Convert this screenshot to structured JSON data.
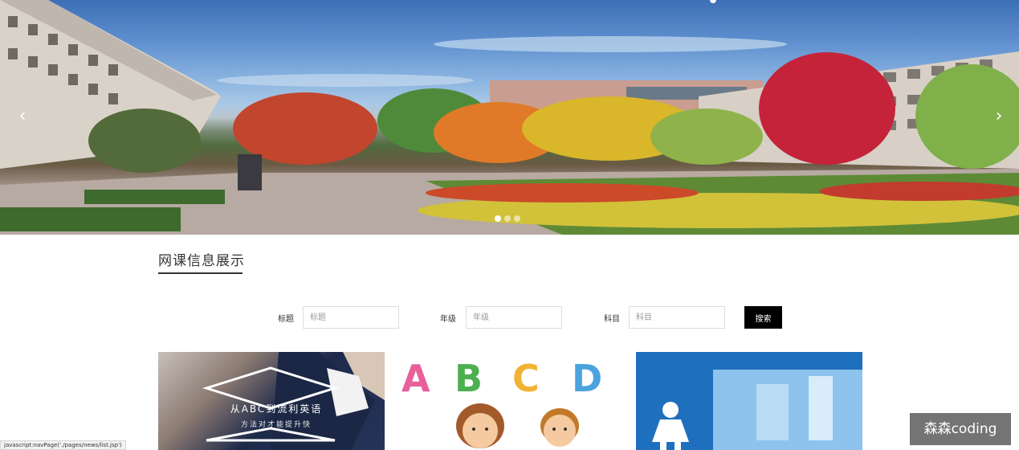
{
  "banner": {
    "prev_arrow": "‹",
    "next_arrow": "›",
    "slide_count": 3,
    "active_slide": 1
  },
  "section": {
    "title": "网课信息展示"
  },
  "search": {
    "title_label": "标题",
    "title_placeholder": "标题",
    "grade_label": "年级",
    "grade_placeholder": "年级",
    "subject_label": "科目",
    "subject_placeholder": "科目",
    "button_label": "搜索"
  },
  "cards": [
    {
      "title": "从ABC到流利英语",
      "subtitle": "方法对才能提升快"
    },
    {
      "letters": [
        "A",
        "B",
        "C",
        "D"
      ]
    },
    {}
  ],
  "status_bar": {
    "text": "javascript:navPage('./pages/news/list.jsp')"
  },
  "watermark": {
    "text": "森森coding"
  },
  "colors": {
    "button_bg": "#000000",
    "title_underline": "#333333",
    "letter_a": "#e8609a",
    "letter_b": "#4caf50",
    "letter_c": "#f2b233",
    "letter_d": "#4aa3df"
  }
}
